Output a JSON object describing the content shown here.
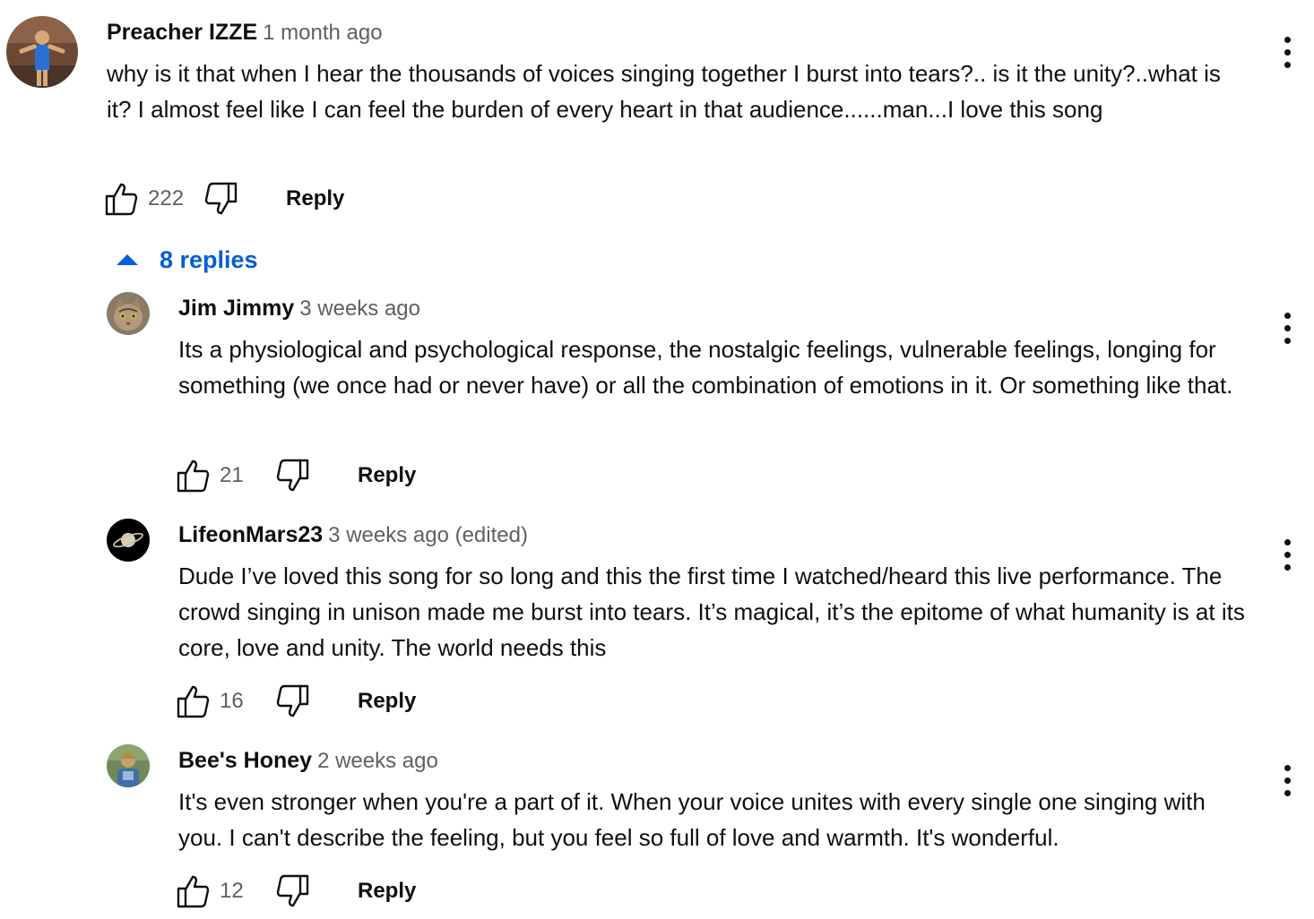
{
  "top_comment": {
    "author": "Preacher IZZE",
    "time": "1 month ago",
    "text": "why is it that when I hear the thousands of voices singing together I burst into tears?.. is it the unity?..what is it? I almost feel like I can feel the burden of every heart in that audience......man...I love this song",
    "likes": "222",
    "reply_label": "Reply"
  },
  "replies_toggle": {
    "label": "8 replies"
  },
  "replies": [
    {
      "author": "Jim Jimmy",
      "time": "3 weeks ago",
      "text": "Its a physiological and psychological response, the nostalgic feelings, vulnerable feelings, longing for something (we once had or never have) or all the combination of emotions in it. Or something like that.",
      "likes": "21",
      "reply_label": "Reply"
    },
    {
      "author": "LifeonMars23",
      "time": "3 weeks ago (edited)",
      "text": "Dude I’ve loved this song for so long and this the first time I watched/heard this live performance. The crowd singing in unison made me burst into tears. It’s magical, it’s the epitome of what humanity is at its core, love and unity. The world needs this",
      "likes": "16",
      "reply_label": "Reply"
    },
    {
      "author": "Bee's Honey",
      "time": "2 weeks ago",
      "text": "It's even stronger when you're a part of it. When your voice unites with every single one singing with you. I can't describe the feeling, but you feel so full of love and warmth. It's wonderful.",
      "likes": "12",
      "reply_label": "Reply"
    }
  ],
  "icons": {
    "like": "thumb-up-icon",
    "dislike": "thumb-down-icon",
    "menu": "more-vert-icon",
    "toggle": "caret-up-icon"
  },
  "colors": {
    "link_blue": "#065fd4",
    "secondary_text": "#606060"
  }
}
